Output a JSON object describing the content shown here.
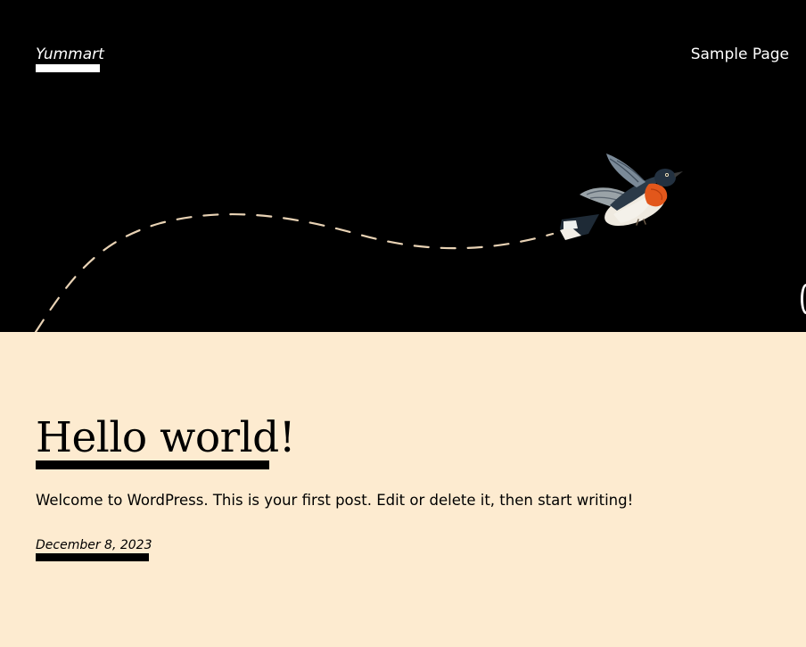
{
  "header": {
    "site_title": "Yummart",
    "nav": [
      {
        "label": "Sample Page"
      }
    ]
  },
  "hero": {
    "illustration": "bird-with-dashed-flight-path",
    "background_color": "#000000",
    "path_color": "#e8d2b4"
  },
  "post": {
    "title": "Hello world!",
    "excerpt": "Welcome to WordPress. This is your first post. Edit or delete it, then start writing!",
    "date": "December 8, 2023"
  },
  "theme": {
    "page_background": "#fdebd0",
    "text_color": "#000000"
  }
}
